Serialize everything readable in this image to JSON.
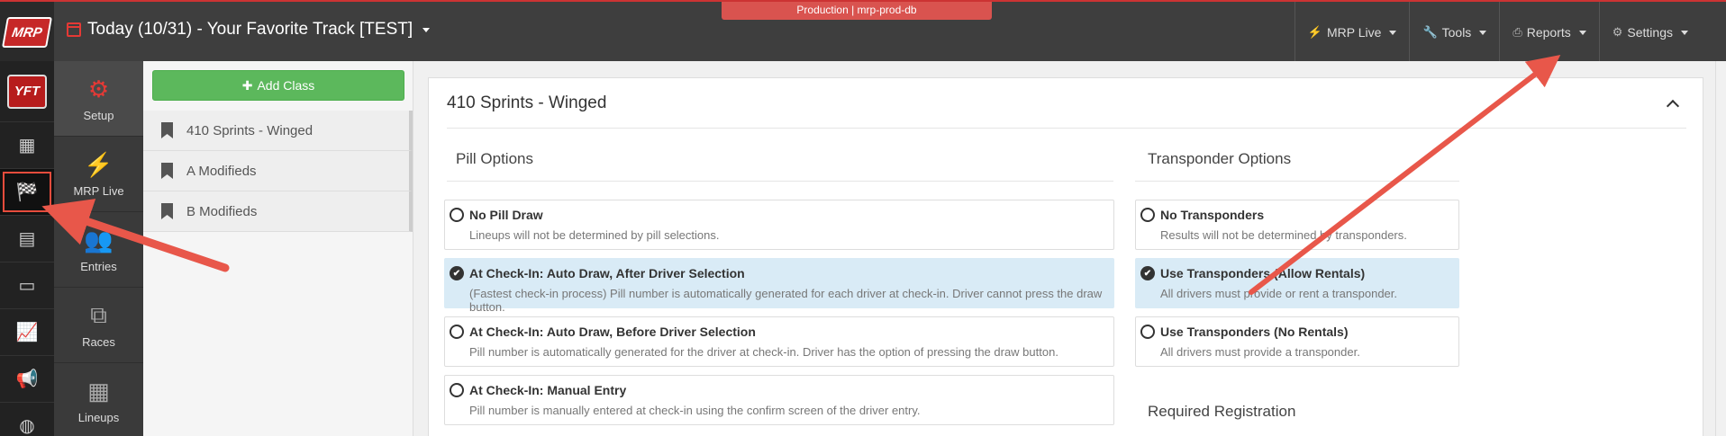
{
  "header": {
    "app_logo": "MRP",
    "track_title": "Today (10/31) - Your Favorite Track [TEST]",
    "env_badge": "Production | mrp-prod-db",
    "nav": [
      {
        "label": "MRP Live",
        "icon": "bolt-icon"
      },
      {
        "label": "Tools",
        "icon": "wrench-icon"
      },
      {
        "label": "Reports",
        "icon": "print-icon"
      },
      {
        "label": "Settings",
        "icon": "gear-icon"
      }
    ]
  },
  "sidebar": {
    "track_logo": "YFT",
    "icons": [
      "calendar-icon",
      "checkered-flag-icon",
      "newspaper-icon",
      "ticket-icon",
      "chart-icon",
      "megaphone-icon",
      "globe-icon"
    ]
  },
  "subnav": {
    "items": [
      {
        "label": "Setup",
        "icon": "gear-icon"
      },
      {
        "label": "MRP Live",
        "icon": "bolt-icon"
      },
      {
        "label": "Entries",
        "icon": "users-icon"
      },
      {
        "label": "Races",
        "icon": "sitemap-icon"
      },
      {
        "label": "Lineups",
        "icon": "grid-icon"
      }
    ]
  },
  "classes": {
    "add_label": "Add Class",
    "items": [
      "410 Sprints - Winged",
      "A Modifieds",
      "B Modifieds"
    ]
  },
  "panel": {
    "title": "410 Sprints - Winged",
    "pill": {
      "heading": "Pill Options",
      "options": [
        {
          "title": "No Pill Draw",
          "desc": "Lineups will not be determined by pill selections.",
          "selected": false
        },
        {
          "title": "At Check-In: Auto Draw, After Driver Selection",
          "desc": "(Fastest check-in process) Pill number is automatically generated for each driver at check-in. Driver cannot press the draw button.",
          "selected": true
        },
        {
          "title": "At Check-In: Auto Draw, Before Driver Selection",
          "desc": "Pill number is automatically generated for the driver at check-in. Driver has the option of pressing the draw button.",
          "selected": false
        },
        {
          "title": "At Check-In: Manual Entry",
          "desc": "Pill number is manually entered at check-in using the confirm screen of the driver entry.",
          "selected": false
        }
      ]
    },
    "transponder": {
      "heading": "Transponder Options",
      "options": [
        {
          "title": "No Transponders",
          "desc": "Results will not be determined by transponders.",
          "selected": false
        },
        {
          "title": "Use Transponders (Allow Rentals)",
          "desc": "All drivers must provide or rent a transponder.",
          "selected": true
        },
        {
          "title": "Use Transponders (No Rentals)",
          "desc": "All drivers must provide a transponder.",
          "selected": false
        }
      ]
    },
    "required_heading": "Required Registration"
  },
  "colors": {
    "accent": "#e53935",
    "success": "#5cb85c",
    "selected_bg": "#d9ebf6",
    "annotation": "#e8574a"
  }
}
